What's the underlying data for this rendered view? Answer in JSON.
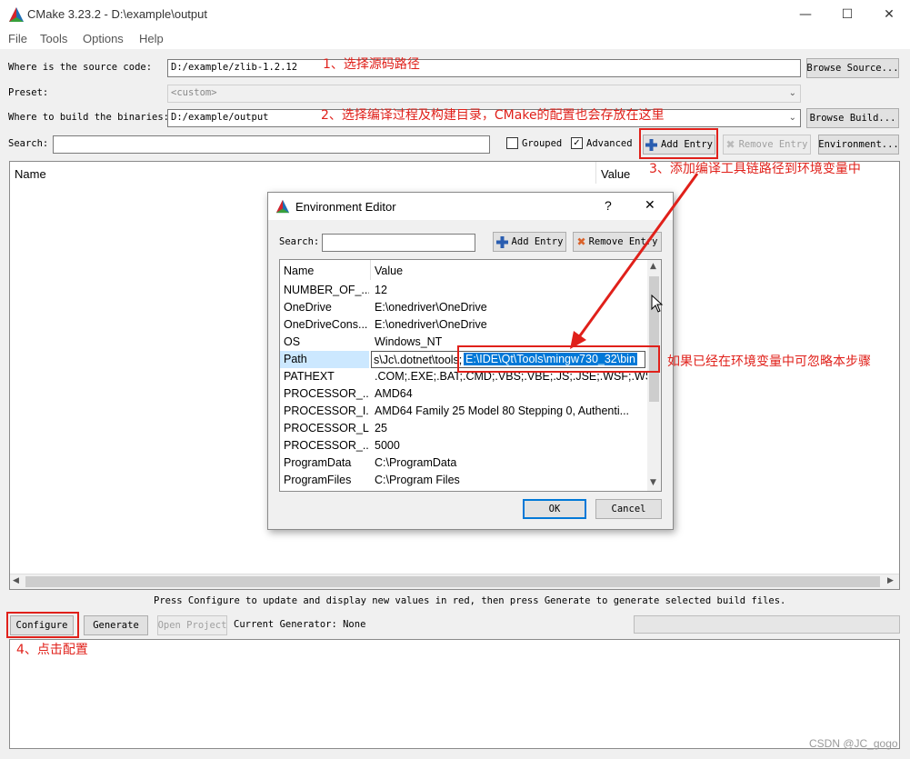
{
  "window": {
    "title": "CMake 3.23.2 - D:\\example\\output",
    "minimize_glyph": "—",
    "maximize_glyph": "☐",
    "close_glyph": "✕"
  },
  "menu": [
    "File",
    "Tools",
    "Options",
    "Help"
  ],
  "source": {
    "label": "Where is the source code:",
    "value": "D:/example/zlib-1.2.12",
    "browse": "Browse Source..."
  },
  "preset": {
    "label": "Preset:",
    "value": "<custom>"
  },
  "build": {
    "label": "Where to build the binaries:",
    "value": "D:/example/output",
    "browse": "Browse Build..."
  },
  "search": {
    "label": "Search:",
    "value": ""
  },
  "options": {
    "grouped": "Grouped",
    "grouped_checked": false,
    "advanced": "Advanced",
    "advanced_checked": true
  },
  "toolbar": {
    "add_entry": "Add Entry",
    "remove_entry": "Remove Entry",
    "environment": "Environment..."
  },
  "table": {
    "name_col": "Name",
    "value_col": "Value"
  },
  "status_text": "Press Configure to update and display new values in red, then press Generate to generate selected build files.",
  "bottom": {
    "configure": "Configure",
    "generate": "Generate",
    "open_project": "Open Project",
    "generator": "Current Generator: None"
  },
  "annotations": {
    "a1": "1、选择源码路径",
    "a2": "2、选择编译过程及构建目录，CMake的配置也会存放在这里",
    "a3": "3、添加编译工具链路径到环境变量中",
    "a4": "4、点击配置",
    "a5": "如果已经在环境变量中可忽略本步骤"
  },
  "dialog": {
    "title": "Environment Editor",
    "help_glyph": "?",
    "close_glyph": "✕",
    "search_label": "Search:",
    "search_value": "",
    "add_entry": "Add Entry",
    "remove_entry": "Remove Entry",
    "name_col": "Name",
    "value_col": "Value",
    "rows": [
      {
        "name": "NUMBER_OF_...",
        "value": "12"
      },
      {
        "name": "OneDrive",
        "value": "E:\\onedriver\\OneDrive"
      },
      {
        "name": "OneDriveCons...",
        "value": "E:\\onedriver\\OneDrive"
      },
      {
        "name": "OS",
        "value": "Windows_NT"
      },
      {
        "name": "Path",
        "value": "s\\Jc\\.dotnet\\tools;"
      },
      {
        "name": "PATHEXT",
        "value": ".COM;.EXE;.BAT;.CMD;.VBS;.VBE;.JS;.JSE;.WSF;.WS..."
      },
      {
        "name": "PROCESSOR_...",
        "value": "AMD64"
      },
      {
        "name": "PROCESSOR_I...",
        "value": "AMD64 Family 25 Model 80 Stepping 0, Authenti..."
      },
      {
        "name": "PROCESSOR_L...",
        "value": "25"
      },
      {
        "name": "PROCESSOR_...",
        "value": "5000"
      },
      {
        "name": "ProgramData",
        "value": "C:\\ProgramData"
      },
      {
        "name": "ProgramFiles",
        "value": "C:\\Program Files"
      }
    ],
    "path_edit_value": "E:\\IDE\\Qt\\Tools\\mingw730_32\\bin",
    "ok": "OK",
    "cancel": "Cancel"
  },
  "watermark": "CSDN @JC_gogo",
  "colors": {
    "annotation_red": "#e0201a",
    "selection_blue": "#0078d7",
    "path_row_highlight": "#cce8ff"
  }
}
